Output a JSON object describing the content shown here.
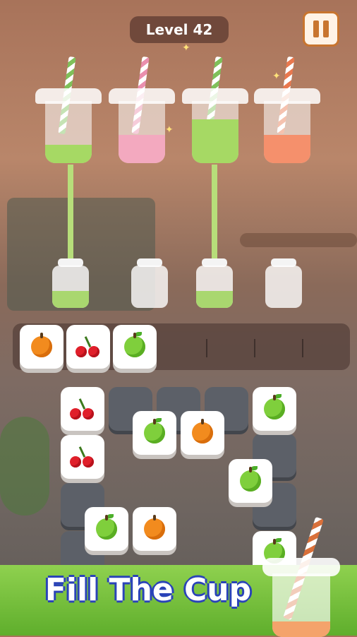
{
  "hud": {
    "level_label": "Level 42"
  },
  "cups": [
    {
      "juice": "green",
      "color": "#a6d964",
      "fill_fraction": 0.3,
      "straw_color": "#7fc05a"
    },
    {
      "juice": "pink",
      "color": "#f3a9bf",
      "fill_fraction": 0.45,
      "straw_color": "#ea8fae"
    },
    {
      "juice": "green",
      "color": "#a6d964",
      "fill_fraction": 0.7,
      "straw_color": "#7fc05a"
    },
    {
      "juice": "orange",
      "color": "#f5906c",
      "fill_fraction": 0.45,
      "straw_color": "#e9784e"
    }
  ],
  "jars": [
    {
      "fill": "green",
      "filled": true
    },
    {
      "fill": "empty",
      "filled": false
    },
    {
      "fill": "green",
      "filled": true
    },
    {
      "fill": "empty",
      "filled": false
    }
  ],
  "tray": {
    "slot_count": 7,
    "items": [
      "orange",
      "cherry",
      "apple"
    ]
  },
  "board_tiles": [
    "cherry",
    "apple",
    "apple",
    "orange",
    "cherry",
    "apple",
    "apple",
    "orange",
    "apple"
  ],
  "banner": {
    "text": "Fill The Cup"
  },
  "colors": {
    "banner_green": "#7cc43f",
    "banner_text_outline": "#2a43b8",
    "pause_accent": "#c8752f"
  }
}
